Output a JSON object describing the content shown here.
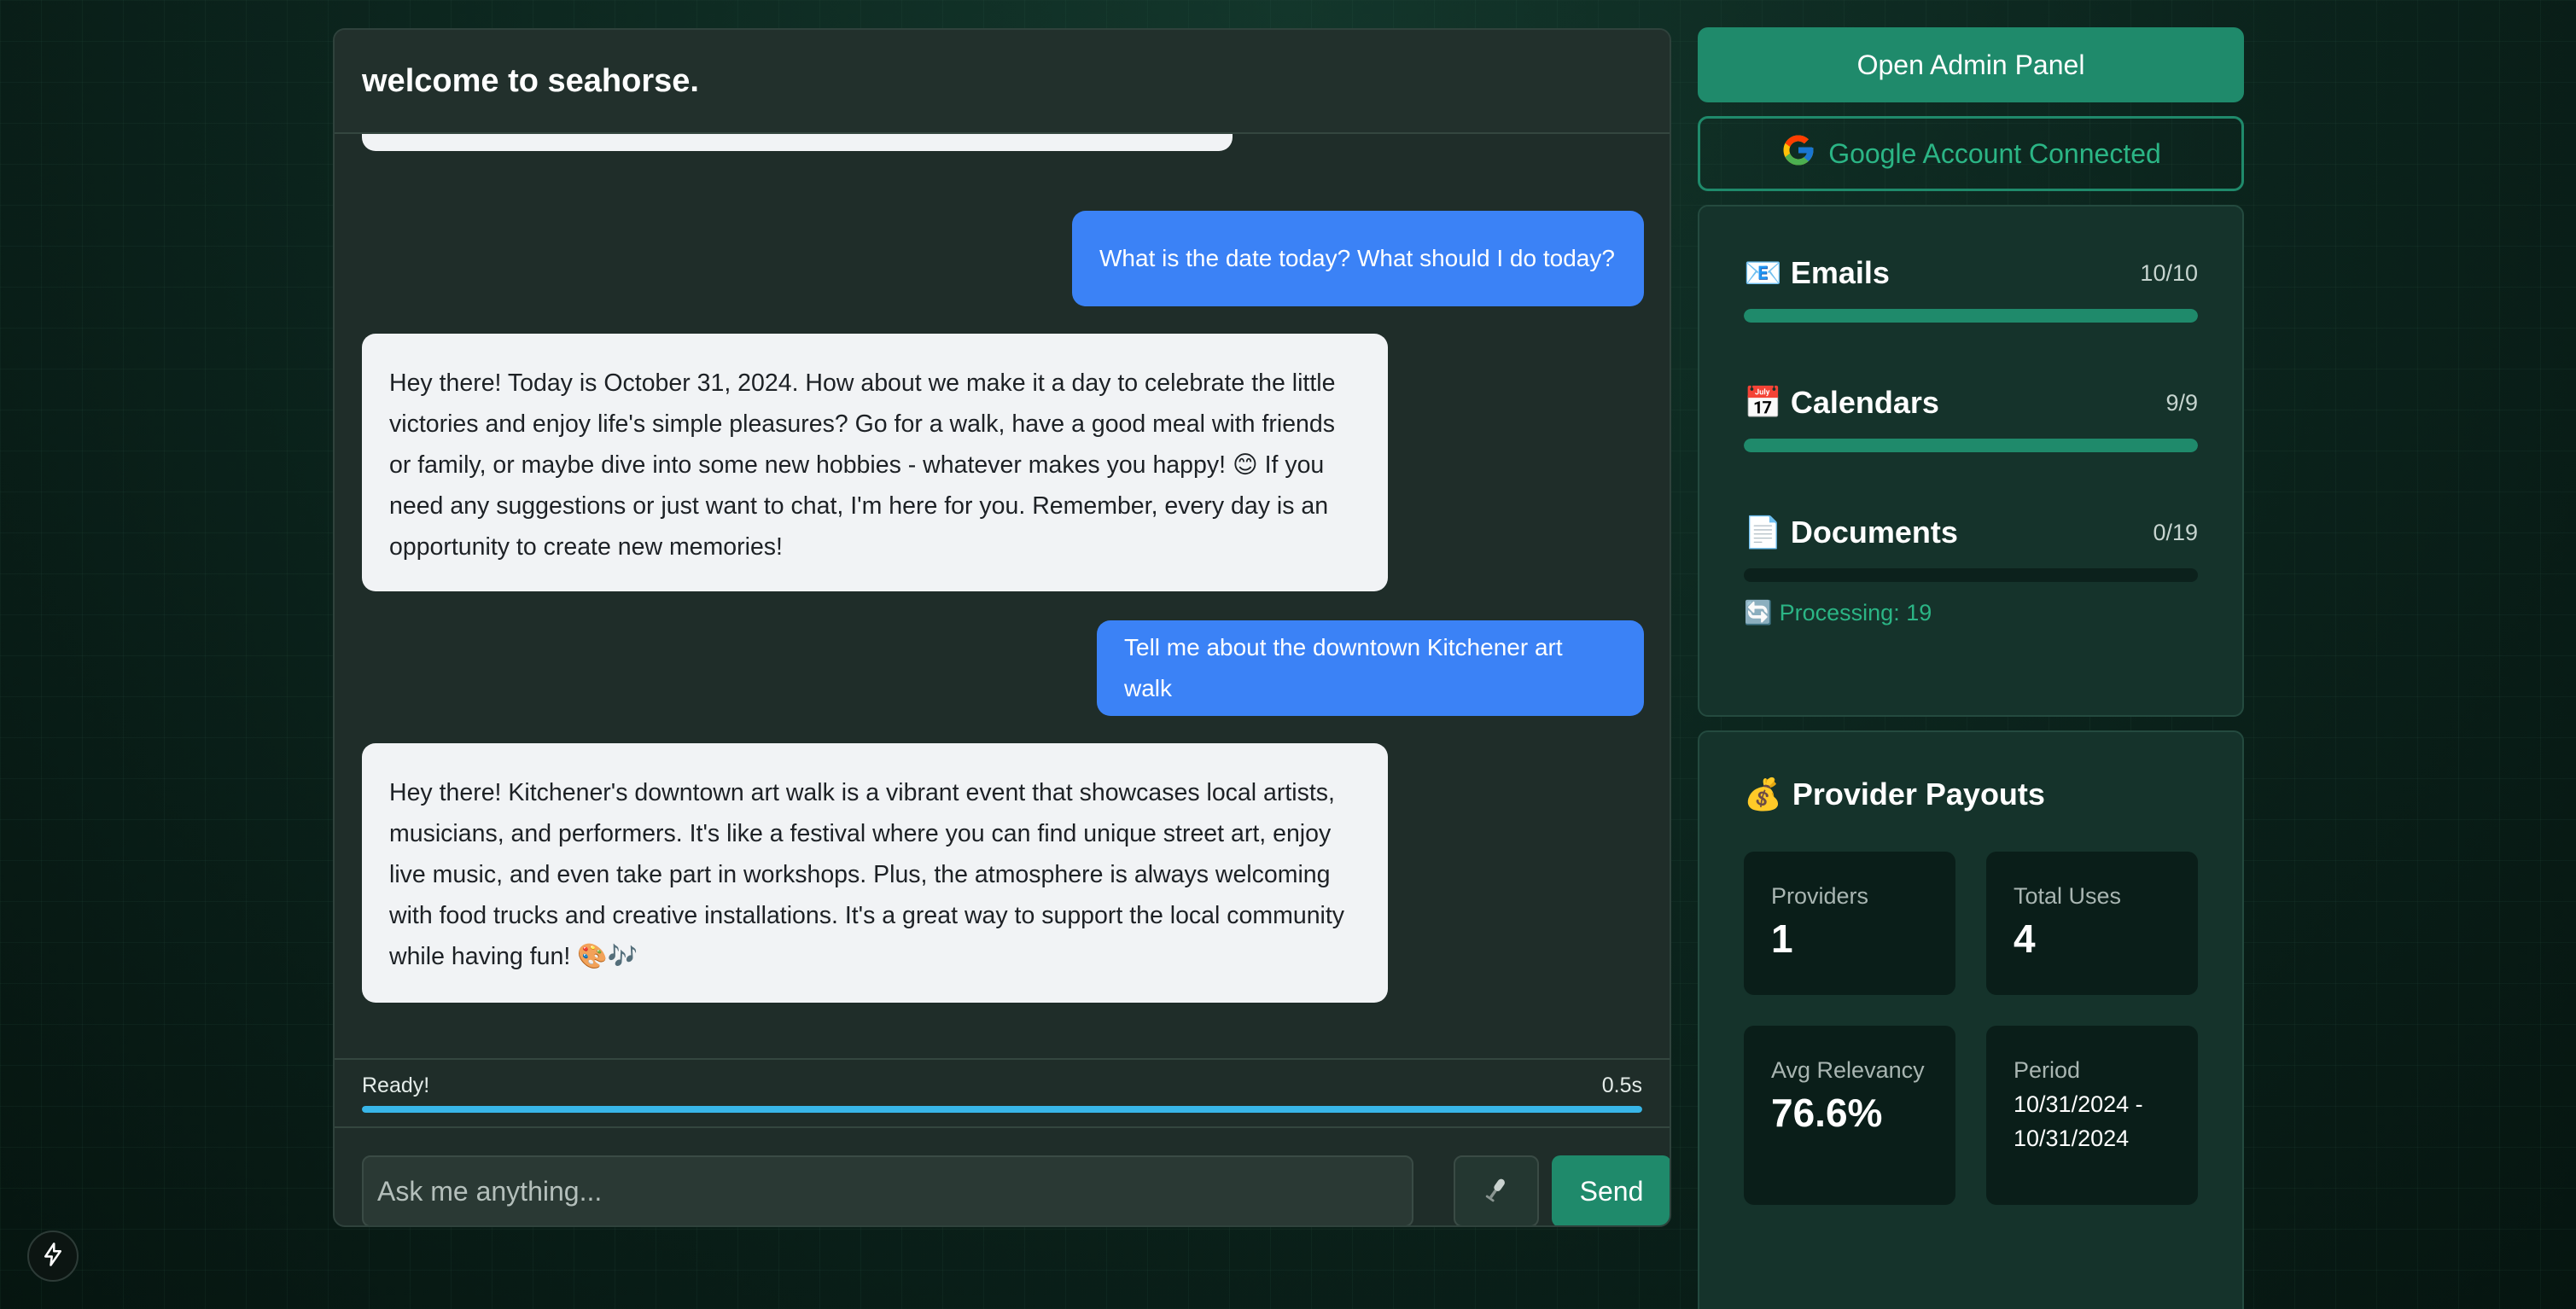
{
  "chat": {
    "title": "welcome to seahorse.",
    "messages": [
      {
        "role": "user",
        "text": "What is the date today? What should I do today?"
      },
      {
        "role": "assistant",
        "text": "Hey there! Today is October 31, 2024. How about we make it a day to celebrate the little victories and enjoy life's simple pleasures? Go for a walk, have a good meal with friends or family, or maybe dive into some new hobbies - whatever makes you happy! 😊 If you need any suggestions or just want to chat, I'm here for you. Remember, every day is an opportunity to create new memories!"
      },
      {
        "role": "user",
        "text": "Tell me about the downtown Kitchener art walk"
      },
      {
        "role": "assistant",
        "text": "Hey there! Kitchener's downtown art walk is a vibrant event that showcases local artists, musicians, and performers. It's like a festival where you can find unique street art, enjoy live music, and even take part in workshops. Plus, the atmosphere is always welcoming with food trucks and creative installations. It's a great way to support the local community while having fun! 🎨🎶"
      }
    ],
    "status": {
      "text": "Ready!",
      "time": "0.5s",
      "progress_pct": 100
    },
    "input": {
      "placeholder": "Ask me anything...",
      "value": ""
    },
    "mic_icon": "microphone-icon",
    "send_label": "Send"
  },
  "sidebar": {
    "admin_label": "Open Admin Panel",
    "google_label": "Google Account Connected",
    "sync": [
      {
        "icon": "📧",
        "label": "Emails",
        "count": "10/10",
        "done": 10,
        "total": 10
      },
      {
        "icon": "📅",
        "label": "Calendars",
        "count": "9/9",
        "done": 9,
        "total": 9
      },
      {
        "icon": "📄",
        "label": "Documents",
        "count": "0/19",
        "done": 0,
        "total": 19
      }
    ],
    "processing": {
      "icon": "🔄",
      "text": "Processing: 19"
    },
    "payouts": {
      "icon": "💰",
      "title": "Provider Payouts",
      "providers_label": "Providers",
      "providers_value": "1",
      "uses_label": "Total Uses",
      "uses_value": "4",
      "relevancy_label": "Avg Relevancy",
      "relevancy_value": "76.6%",
      "period_label": "Period",
      "period_value": "10/31/2024 - 10/31/2024"
    }
  },
  "colors": {
    "accent": "#1f8a6b",
    "user_bubble": "#3b82f6",
    "progress": "#38b6e8"
  }
}
